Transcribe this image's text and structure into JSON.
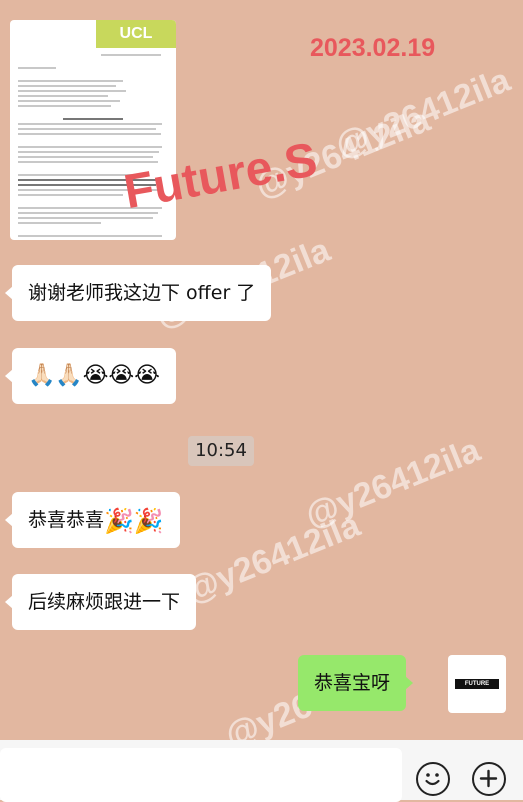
{
  "date_stamp": "2023.02.19",
  "watermark": "@y26412ila",
  "overlay_brand": "Future.S",
  "offer_letter": {
    "logo": "UCL"
  },
  "messages": [
    {
      "text": "谢谢老师我这边下 offer 了",
      "sender": "other"
    },
    {
      "text": "🙏🏻🙏🏻😭😭😭",
      "sender": "other"
    },
    {
      "text": "恭喜恭喜",
      "emoji": "🎉🎉",
      "sender": "other"
    },
    {
      "text": "后续麻烦跟进一下",
      "sender": "other"
    },
    {
      "text": "恭喜宝呀",
      "sender": "me"
    }
  ],
  "time_divider": "10:54",
  "avatar": {
    "label": "FUTURE STUDIO"
  },
  "composer": {
    "input_value": "",
    "emoji_icon": "smiley-icon",
    "add_icon": "plus-icon"
  }
}
